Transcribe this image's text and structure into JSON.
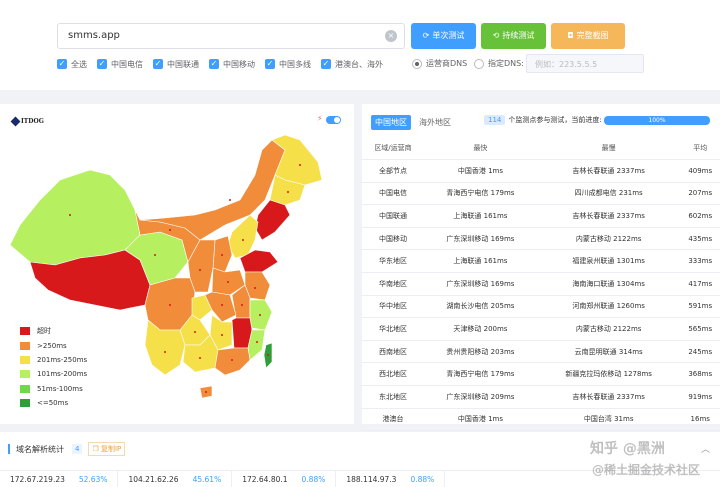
{
  "search": {
    "value": "smms.app"
  },
  "buttons": {
    "single": "单次测试",
    "continuous": "持续测试",
    "screenshot": "完整截图"
  },
  "checkboxes": [
    {
      "label": "全选",
      "checked": true
    },
    {
      "label": "中国电信",
      "checked": true
    },
    {
      "label": "中国联通",
      "checked": true
    },
    {
      "label": "中国移动",
      "checked": true
    },
    {
      "label": "中国多线",
      "checked": true
    },
    {
      "label": "港澳台、海外",
      "checked": true
    }
  ],
  "dns": {
    "carrier_label": "运营商DNS",
    "custom_label": "指定DNS:",
    "placeholder": "例如：223.5.5.5"
  },
  "map": {
    "logo": "ITDOG",
    "legend": [
      {
        "label": "超时",
        "color": "#d7191c"
      },
      {
        "label": ">250ms",
        "color": "#f08c3a"
      },
      {
        "label": "201ms-250ms",
        "color": "#f5e04a"
      },
      {
        "label": "101ms-200ms",
        "color": "#b6f061"
      },
      {
        "label": "51ms-100ms",
        "color": "#6fd94b"
      },
      {
        "label": "<=50ms",
        "color": "#2e9e38"
      }
    ]
  },
  "results": {
    "tabs": [
      "中国地区",
      "海外地区"
    ],
    "count": "114",
    "count_text": "个监测点参与测试，当前进度:",
    "progress": "100%",
    "progress_value": 1.0,
    "headers": [
      "区域/运营商",
      "最快",
      "最慢",
      "平均"
    ],
    "rows": [
      [
        "全部节点",
        "中国香港 1ms",
        "吉林长春联通 2337ms",
        "409ms"
      ],
      [
        "中国电信",
        "青海西宁电信 179ms",
        "四川成都电信 231ms",
        "207ms"
      ],
      [
        "中国联通",
        "上海联通 161ms",
        "吉林长春联通 2337ms",
        "602ms"
      ],
      [
        "中国移动",
        "广东深圳移动 169ms",
        "内蒙古移动 2122ms",
        "435ms"
      ],
      [
        "华东地区",
        "上海联通 161ms",
        "福建泉州联通 1301ms",
        "333ms"
      ],
      [
        "华南地区",
        "广东深圳移动 169ms",
        "海南海口联通 1304ms",
        "417ms"
      ],
      [
        "华中地区",
        "湖南长沙电信 205ms",
        "河南郑州联通 1260ms",
        "591ms"
      ],
      [
        "华北地区",
        "天津移动 200ms",
        "内蒙古移动 2122ms",
        "565ms"
      ],
      [
        "西南地区",
        "贵州贵阳移动 203ms",
        "云南昆明联通 314ms",
        "245ms"
      ],
      [
        "西北地区",
        "青海西宁电信 179ms",
        "新疆克拉玛依移动 1278ms",
        "368ms"
      ],
      [
        "东北地区",
        "广东深圳移动 209ms",
        "吉林长春联通 2337ms",
        "919ms"
      ],
      [
        "港澳台",
        "中国香港 1ms",
        "中国台湾 31ms",
        "16ms"
      ]
    ]
  },
  "dns_stats": {
    "title": "域名解析统计",
    "count": "4",
    "copy_label": "复制IP",
    "ips": [
      {
        "ip": "172.67.219.23",
        "pct": "52.63%"
      },
      {
        "ip": "104.21.62.26",
        "pct": "45.61%"
      },
      {
        "ip": "172.64.80.1",
        "pct": "0.88%"
      },
      {
        "ip": "188.114.97.3",
        "pct": "0.88%"
      }
    ]
  },
  "watermark": {
    "line1": "知乎 @黑洲",
    "line2": "@稀土掘金技术社区"
  }
}
